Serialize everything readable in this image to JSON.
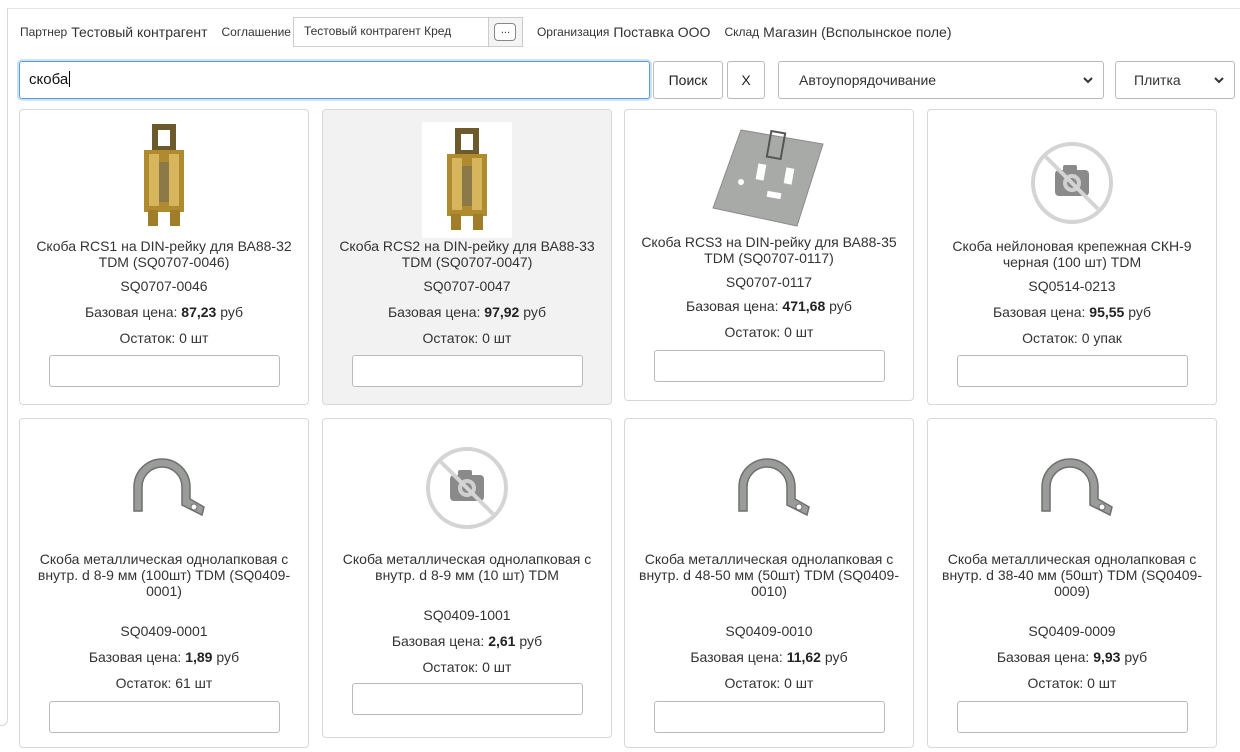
{
  "header": {
    "partner_label": "Партнер",
    "partner_value": "Тестовый контрагент",
    "agreement_label": "Соглашение",
    "agreement_value": "Тестовый контрагент Кред",
    "dots_label": "...",
    "org_label": "Организация",
    "org_value": "Поставка ООО",
    "warehouse_label": "Склад",
    "warehouse_value": "Магазин (Всполынское поле)"
  },
  "search": {
    "value": "скоба",
    "search_button": "Поиск",
    "clear_button": "X",
    "sort_selected": "Автоупорядочивание",
    "view_selected": "Плитка"
  },
  "colors": {
    "accent_border": "#5b9bd5",
    "card_border": "#d8d8d8",
    "highlight_bg": "#f2f2f2"
  },
  "products": [
    {
      "name": "Скоба RCS1 на DIN-рейку для ВА88-32 TDM (SQ0707-0046)",
      "sku": "SQ0707-0046",
      "price_label": "Базовая цена:",
      "price": "87,23",
      "currency": "руб",
      "stock": "Остаток: 0 шт",
      "image": "din-bracket-icon"
    },
    {
      "name": "Скоба RCS2 на DIN-рейку для ВА88-33 TDM (SQ0707-0047)",
      "sku": "SQ0707-0047",
      "price_label": "Базовая цена:",
      "price": "97,92",
      "currency": "руб",
      "stock": "Остаток: 0 шт",
      "image": "din-bracket-icon"
    },
    {
      "name": "Скоба RCS3 на DIN-рейку для ВА88-35 TDM (SQ0707-0117)",
      "sku": "SQ0707-0117",
      "price_label": "Базовая цена:",
      "price": "471,68",
      "currency": "руб",
      "stock": "Остаток: 0 шт",
      "image": "mounting-plate-icon"
    },
    {
      "name": "Скоба нейлоновая крепежная СКН-9 черная (100 шт) TDM",
      "sku": "SQ0514-0213",
      "price_label": "Базовая цена:",
      "price": "95,55",
      "currency": "руб",
      "stock": "Остаток: 0 упак",
      "image": "no-photo-icon"
    },
    {
      "name": "Скоба металлическая однолапковая с внутр. d 8-9 мм (100шт) TDM (SQ0409-0001)",
      "sku": "SQ0409-0001",
      "price_label": "Базовая цена:",
      "price": "1,89",
      "currency": "руб",
      "stock": "Остаток: 61 шт",
      "image": "pipe-clamp-icon"
    },
    {
      "name": "Скоба металлическая однолапковая с внутр. d 8-9 мм (10 шт) TDM",
      "sku": "SQ0409-1001",
      "price_label": "Базовая цена:",
      "price": "2,61",
      "currency": "руб",
      "stock": "Остаток: 0 шт",
      "image": "no-photo-icon"
    },
    {
      "name": "Скоба металлическая однолапковая с внутр. d 48-50 мм (50шт) TDM (SQ0409-0010)",
      "sku": "SQ0409-0010",
      "price_label": "Базовая цена:",
      "price": "11,62",
      "currency": "руб",
      "stock": "Остаток: 0 шт",
      "image": "pipe-clamp-icon"
    },
    {
      "name": "Скоба металлическая однолапковая с внутр. d 38-40 мм (50шт) TDM (SQ0409-0009)",
      "sku": "SQ0409-0009",
      "price_label": "Базовая цена:",
      "price": "9,93",
      "currency": "руб",
      "stock": "Остаток: 0 шт",
      "image": "pipe-clamp-icon"
    }
  ]
}
